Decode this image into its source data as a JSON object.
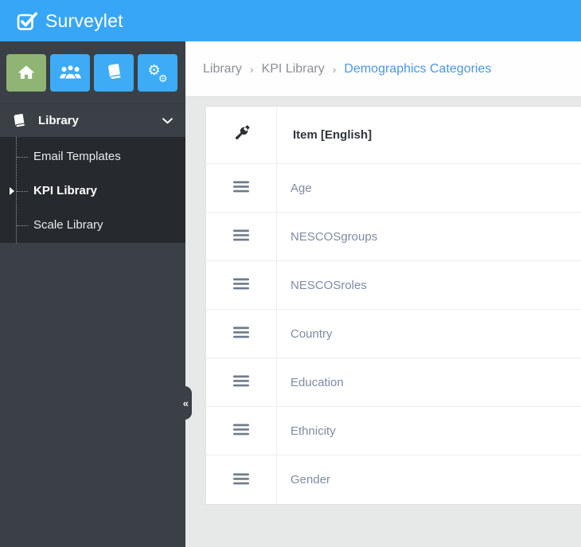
{
  "app": {
    "title": "Surveylet",
    "logo_icon": "check-square"
  },
  "colors": {
    "header_blue": "#38a6f6",
    "toolbar_button_blue": "#3dabf5",
    "home_button_green": "#8fb474",
    "sidebar_dark": "#3a4046",
    "submenu_dark": "#26292d",
    "breadcrumb_active_blue": "#4a96e2",
    "breadcrumb_gray": "#8b9097",
    "row_text_gray_blue": "#7d8ca3",
    "content_background": "#e7e8e8"
  },
  "sidebar": {
    "toolbar_buttons": [
      {
        "name": "home",
        "icon": "home-icon"
      },
      {
        "name": "users",
        "icon": "users-icon"
      },
      {
        "name": "library",
        "icon": "book-icon"
      },
      {
        "name": "settings",
        "icon": "gears-icon"
      }
    ],
    "menu": {
      "label": "Library",
      "icon": "book-icon",
      "state_icon": "chevron-down"
    },
    "submenu": [
      {
        "label": "Email Templates",
        "active": false
      },
      {
        "label": "KPI Library",
        "active": true
      },
      {
        "label": "Scale Library",
        "active": false
      }
    ],
    "collapse_glyph": "«"
  },
  "breadcrumb": {
    "separator": "›",
    "items": [
      {
        "label": "Library"
      },
      {
        "label": "KPI Library"
      },
      {
        "label": "Demographics Categories"
      }
    ]
  },
  "table": {
    "header": {
      "actions_icon": "wrench-icon",
      "item_label": "Item [English]"
    },
    "row_icon": "hamburger-menu",
    "rows": [
      {
        "item": "Age"
      },
      {
        "item": "NESCOSgroups"
      },
      {
        "item": "NESCOSroles"
      },
      {
        "item": "Country"
      },
      {
        "item": "Education"
      },
      {
        "item": "Ethnicity"
      },
      {
        "item": "Gender"
      }
    ]
  }
}
